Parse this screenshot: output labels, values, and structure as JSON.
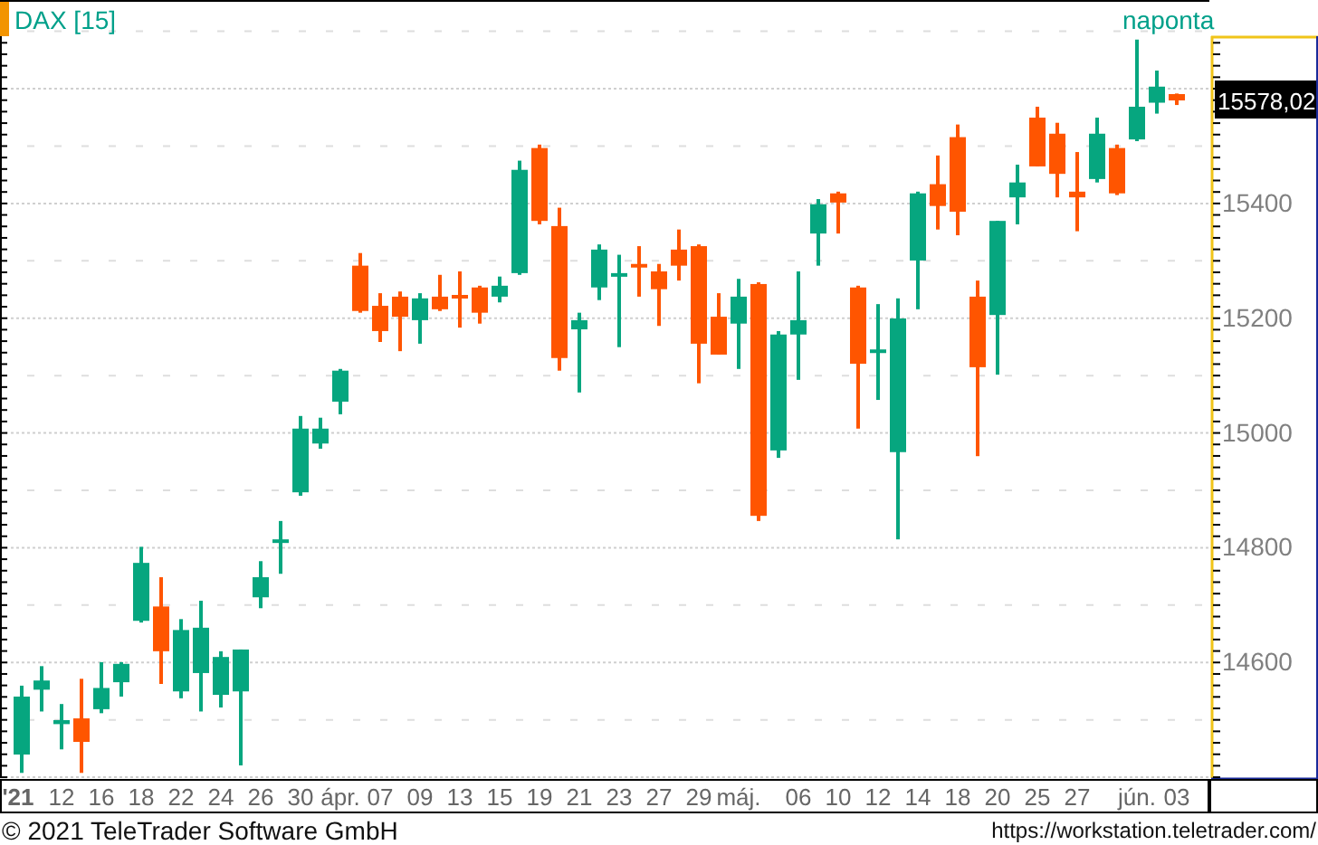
{
  "chart": {
    "instrument": "DAX [15]",
    "period": "naponta",
    "last_price": "15578,02",
    "chart_data": {
      "type": "candlestick",
      "grid": true,
      "ylim": [
        14397,
        15753
      ],
      "yticks": [
        14600,
        14800,
        15000,
        15200,
        15400
      ],
      "categories": [
        "'21",
        null,
        "12",
        null,
        "16",
        null,
        "18",
        null,
        "22",
        null,
        "24",
        null,
        "26",
        null,
        "30",
        null,
        "ápr.",
        null,
        "07",
        null,
        "09",
        null,
        "13",
        null,
        "15",
        null,
        "19",
        null,
        "21",
        null,
        "23",
        null,
        "27",
        null,
        "29",
        null,
        "máj.",
        null,
        null,
        "06",
        null,
        "10",
        null,
        "12",
        null,
        "14",
        null,
        "18",
        null,
        "20",
        null,
        "25",
        null,
        "27",
        null,
        null,
        "jún.",
        null,
        "03"
      ],
      "ohlc": [
        [
          14438,
          14558,
          14406,
          14539
        ],
        [
          14551,
          14592,
          14513,
          14567
        ],
        [
          14491,
          14526,
          14447,
          14498
        ],
        [
          14501,
          14570,
          14406,
          14460
        ],
        [
          14517,
          14599,
          14510,
          14554
        ],
        [
          14564,
          14599,
          14539,
          14596
        ],
        [
          14671,
          14800,
          14668,
          14772
        ],
        [
          14696,
          14747,
          14561,
          14618
        ],
        [
          14548,
          14674,
          14536,
          14655
        ],
        [
          14580,
          14706,
          14513,
          14659
        ],
        [
          14542,
          14618,
          14520,
          14608
        ],
        [
          14548,
          14621,
          14419,
          14621
        ],
        [
          14712,
          14775,
          14693,
          14747
        ],
        [
          14807,
          14845,
          14753,
          14813
        ],
        [
          14895,
          15028,
          14889,
          15006
        ],
        [
          14980,
          15025,
          14971,
          15006
        ],
        [
          15053,
          15110,
          15031,
          15107
        ],
        [
          15290,
          15312,
          15208,
          15211
        ],
        [
          15220,
          15242,
          15157,
          15176
        ],
        [
          15236,
          15245,
          15141,
          15201
        ],
        [
          15195,
          15242,
          15154,
          15233
        ],
        [
          15236,
          15274,
          15211,
          15214
        ],
        [
          15239,
          15280,
          15182,
          15233
        ],
        [
          15252,
          15255,
          15189,
          15208
        ],
        [
          15236,
          15271,
          15226,
          15255
        ],
        [
          15277,
          15473,
          15274,
          15457
        ],
        [
          15495,
          15501,
          15362,
          15368
        ],
        [
          15359,
          15391,
          15107,
          15129
        ],
        [
          15179,
          15208,
          15069,
          15195
        ],
        [
          15252,
          15327,
          15230,
          15318
        ],
        [
          15271,
          15309,
          15148,
          15277
        ],
        [
          15293,
          15324,
          15236,
          15290
        ],
        [
          15280,
          15293,
          15185,
          15249
        ],
        [
          15318,
          15353,
          15264,
          15290
        ],
        [
          15324,
          15327,
          15085,
          15154
        ],
        [
          15201,
          15242,
          15135,
          15135
        ],
        [
          15189,
          15267,
          15110,
          15236
        ],
        [
          15258,
          15261,
          14845,
          14854
        ],
        [
          14968,
          15176,
          14955,
          15170
        ],
        [
          15170,
          15280,
          15091,
          15195
        ],
        [
          15346,
          15406,
          15290,
          15397
        ],
        [
          15416,
          15419,
          15346,
          15400
        ],
        [
          15252,
          15255,
          15006,
          15119
        ],
        [
          15141,
          15223,
          15056,
          15144
        ],
        [
          14965,
          15233,
          14813,
          15198
        ],
        [
          15299,
          15419,
          15214,
          15416
        ],
        [
          15432,
          15482,
          15353,
          15394
        ],
        [
          15514,
          15536,
          15343,
          15384
        ],
        [
          15236,
          15264,
          14958,
          15113
        ],
        [
          15204,
          15368,
          15100,
          15368
        ],
        [
          15409,
          15466,
          15362,
          15435
        ],
        [
          15548,
          15567,
          15463,
          15463
        ],
        [
          15520,
          15539,
          15409,
          15450
        ],
        [
          15419,
          15488,
          15350,
          15409
        ],
        [
          15441,
          15548,
          15435,
          15520
        ],
        [
          15495,
          15501,
          15413,
          15416
        ],
        [
          15510,
          15684,
          15507,
          15567
        ],
        [
          15574,
          15630,
          15555,
          15602
        ],
        [
          15589,
          15590,
          15570,
          15578
        ]
      ]
    }
  },
  "footer": {
    "copyright": "© 2021 TeleTrader Software GmbH",
    "url": "https://workstation.teletrader.com/"
  }
}
